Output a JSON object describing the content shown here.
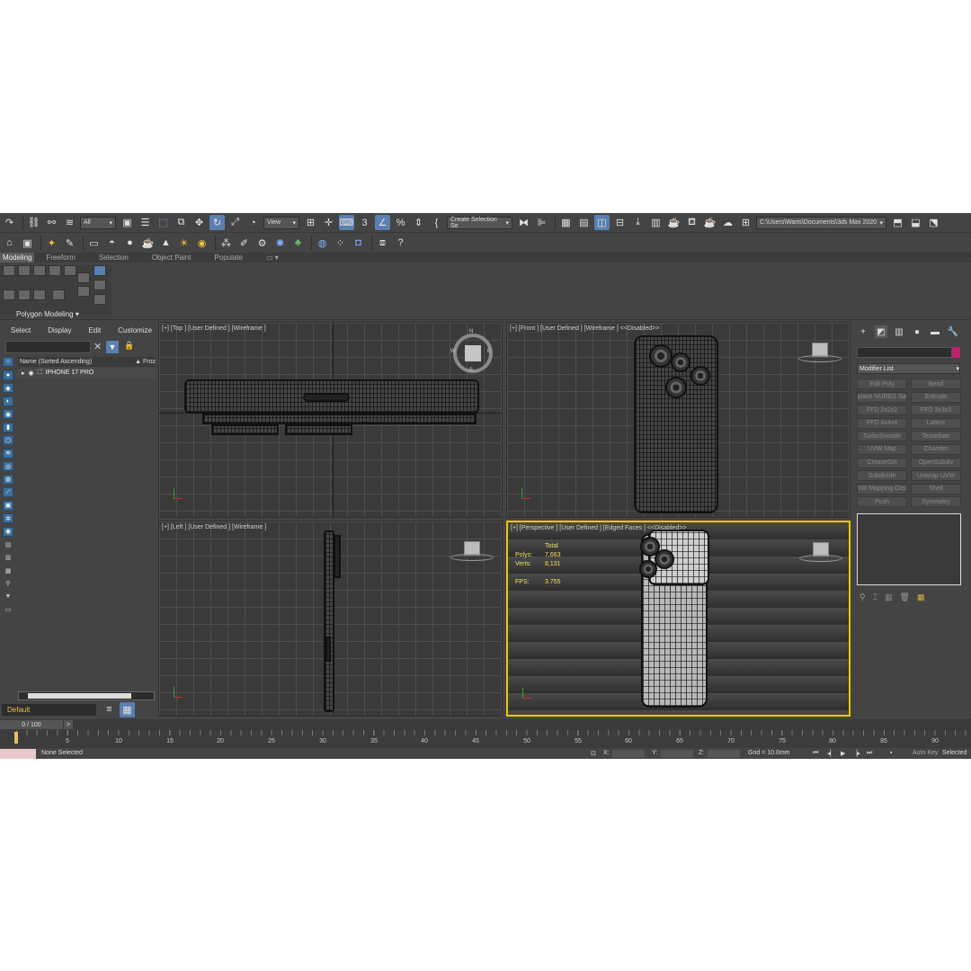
{
  "toolbar": {
    "selection_filter": "All",
    "ref_coord": "View",
    "named_selection": "Create Selection Se",
    "project_path": "C:\\Users\\Waris\\Documents\\3ds Max 2020"
  },
  "ribbon": {
    "tabs": [
      "Modeling",
      "Freeform",
      "Selection",
      "Object Paint",
      "Populate"
    ],
    "panel_label": "Polygon Modeling"
  },
  "explorer": {
    "menu": [
      "Select",
      "Display",
      "Edit",
      "Customize"
    ],
    "column_name": "Name (Sorted Ascending)",
    "column_frozen": "▲ Froz",
    "object_name": "IPHONE 17 PRO",
    "layer": "Default"
  },
  "viewports": {
    "top": "[+] [Top ] [User Defined ] [Wireframe ]",
    "front": "[+] [Front ] [User Defined ] [Wireframe ]  <<Disabled>>",
    "left": "[+] [Left ] [User Defined ] [Wireframe ]",
    "perspective": "[+] [Perspective ] [User Defined ] [Edged Faces ]  <<Disabled>>"
  },
  "stats": {
    "header": "Total",
    "polys_label": "Polys:",
    "polys": "7,663",
    "verts_label": "Verts:",
    "verts": "8,131",
    "fps_label": "FPS:",
    "fps": "3.755"
  },
  "compass": {
    "n": "N",
    "s": "S",
    "e": "E",
    "w": "W"
  },
  "command_panel": {
    "modifier_list": "Modifier List",
    "modifiers": [
      "Edit Poly",
      "Bend",
      "place NURBS Sw",
      "Extrude",
      "FFD 2x2x2",
      "FFD 3x3x3",
      "FFD 4x4x4",
      "Lattice",
      "TurboSmooth",
      "Tessellate",
      "UVW Map",
      "Chamfer",
      "CreaseSet",
      "OpenSubdiv",
      "Subdivide",
      "Unwrap UVW",
      "NW Mapping Clea",
      "Shell",
      "Push",
      "Symmetry"
    ]
  },
  "timeline": {
    "frame": "0 / 100",
    "ticks": [
      "5",
      "10",
      "15",
      "20",
      "25",
      "30",
      "35",
      "40",
      "45",
      "50",
      "55",
      "60",
      "65",
      "70",
      "75",
      "80",
      "85",
      "90"
    ]
  },
  "status": {
    "selection": "None Selected",
    "x_label": "X:",
    "y_label": "Y:",
    "z_label": "Z:",
    "grid": "Grid = 10.0mm",
    "auto_key": "Auto Key",
    "selected": "Selected"
  },
  "colors": {
    "accent": "#5a7fb0",
    "active_viewport": "#e8c800",
    "object_color": "#c01f6f"
  }
}
